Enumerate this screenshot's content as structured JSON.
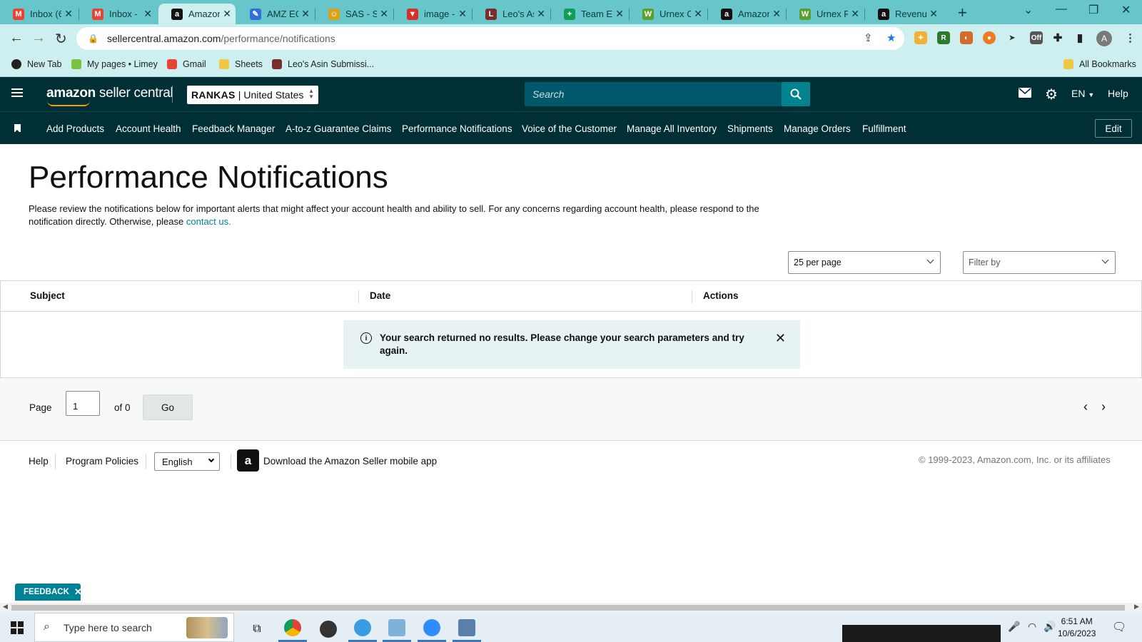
{
  "browser": {
    "tabs": [
      {
        "title": "Inbox (6",
        "icon": "gmail-icon",
        "color": "#ea4335",
        "glyph": "M"
      },
      {
        "title": "Inbox - ",
        "icon": "gmail-icon",
        "color": "#ea4335",
        "glyph": "M"
      },
      {
        "title": "Amazon",
        "icon": "amazon-icon",
        "color": "#111111",
        "glyph": "a"
      },
      {
        "title": "AMZ EC",
        "icon": "pen-icon",
        "color": "#2f6fd6",
        "glyph": "✎"
      },
      {
        "title": "SAS - Se",
        "icon": "sas-icon",
        "color": "#d9a21b",
        "glyph": "☺"
      },
      {
        "title": "image - ",
        "icon": "image-icon",
        "color": "#d93025",
        "glyph": "▼"
      },
      {
        "title": "Leo's As",
        "icon": "asin-icon",
        "color": "#7a2d2d",
        "glyph": "L"
      },
      {
        "title": "Team Ex",
        "icon": "sheets-icon",
        "color": "#0f9d58",
        "glyph": "+"
      },
      {
        "title": "Urnex C",
        "icon": "urnex-icon",
        "color": "#5aa02c",
        "glyph": "W"
      },
      {
        "title": "Amazon",
        "icon": "amazon-icon",
        "color": "#111111",
        "glyph": "a"
      },
      {
        "title": "Urnex R",
        "icon": "urnex-icon",
        "color": "#5aa02c",
        "glyph": "W"
      },
      {
        "title": "Revenue",
        "icon": "amazon-icon",
        "color": "#111111",
        "glyph": "a"
      }
    ],
    "url_host": "sellercentral.amazon.com",
    "url_path": "/performance/notifications",
    "profile_initial": "A",
    "bookmarks": [
      {
        "label": "New Tab",
        "icon": "github-icon",
        "color": "#222222"
      },
      {
        "label": "My pages • Limey",
        "icon": "limey-icon",
        "color": "#7cc242"
      },
      {
        "label": "Gmail",
        "icon": "gmail-icon",
        "color": "#ea4335"
      },
      {
        "label": "Sheets",
        "icon": "folder-icon",
        "color": "#f2c744"
      },
      {
        "label": "Leo's Asin Submissi...",
        "icon": "asin-icon",
        "color": "#7a2d2d"
      }
    ],
    "all_bookmarks": "All Bookmarks"
  },
  "header": {
    "logo_bold": "amazon",
    "logo_rest": " seller central",
    "store": "RANKAS",
    "marketplace": "United States",
    "search_placeholder": "Search",
    "language": "EN",
    "help": "Help"
  },
  "nav": {
    "items": [
      "Add Products",
      "Account Health",
      "Feedback Manager",
      "A-to-z Guarantee Claims",
      "Performance Notifications",
      "Voice of the Customer",
      "Manage All Inventory",
      "Shipments",
      "Manage Orders",
      "Fulfillment"
    ],
    "edit": "Edit"
  },
  "main": {
    "title": "Performance Notifications",
    "intro": "Please review the notifications below for important alerts that might affect your account health and ability to sell. For any concerns regarding account health, please respond to the notification directly. Otherwise, please ",
    "contact_link": "contact us.",
    "per_page": "25 per page",
    "filter_placeholder": "Filter by",
    "columns": [
      "Subject",
      "Date",
      "Actions"
    ],
    "alert": "Your search returned no results. Please change your search parameters and try again."
  },
  "pager": {
    "page_label": "Page",
    "page_value": "1",
    "of_label": "of 0",
    "go": "Go"
  },
  "footer": {
    "help": "Help",
    "policies": "Program Policies",
    "language": "English",
    "app_link": "Download the Amazon Seller mobile app",
    "copyright": "© 1999-2023, Amazon.com, Inc. or its affiliates"
  },
  "feedback": "FEEDBACK",
  "taskbar": {
    "search_placeholder": "Type here to search",
    "time": "6:51 AM",
    "date": "10/6/2023"
  },
  "colors": {
    "header_bg": "#002f36",
    "accent": "#008296",
    "tabstrip": "#67c6c9"
  }
}
